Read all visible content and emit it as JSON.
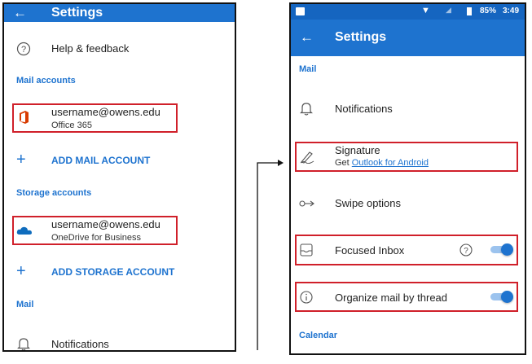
{
  "left_screen": {
    "title": "Settings",
    "help_label": "Help & feedback",
    "mail_accounts_header": "Mail accounts",
    "mail_account": {
      "email": "username@owens.edu",
      "type": "Office 365"
    },
    "add_mail_account": "ADD MAIL ACCOUNT",
    "storage_accounts_header": "Storage accounts",
    "storage_account": {
      "email": "username@owens.edu",
      "type": "OneDrive for Business"
    },
    "add_storage_account": "ADD STORAGE ACCOUNT",
    "mail_header": "Mail",
    "notifications_label": "Notifications"
  },
  "right_screen": {
    "status": {
      "battery": "85%",
      "time": "3:49"
    },
    "title": "Settings",
    "mail_header": "Mail",
    "notifications_label": "Notifications",
    "signature_label": "Signature",
    "signature_sub_prefix": "Get",
    "signature_sub_link": "Outlook for Android",
    "swipe_label": "Swipe options",
    "focused_label": "Focused Inbox",
    "focused_on": true,
    "thread_label": "Organize mail by thread",
    "thread_on": true,
    "calendar_header": "Calendar"
  },
  "colors": {
    "accent": "#1e73cf",
    "highlight": "#d0202a",
    "office_red": "#d83b01",
    "onedrive_blue": "#0f6cbd"
  },
  "icons": [
    "back-arrow-icon",
    "help-circle-icon",
    "office-icon",
    "plus-icon",
    "onedrive-cloud-icon",
    "bell-icon",
    "signature-pen-icon",
    "swipe-icon",
    "focused-inbox-icon",
    "info-icon"
  ]
}
